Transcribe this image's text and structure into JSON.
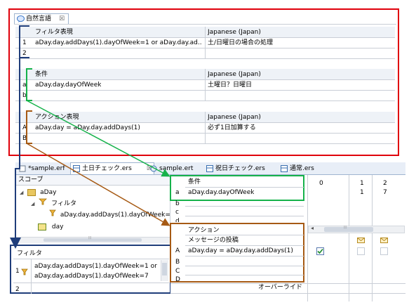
{
  "top_panel": {
    "tab_title": "自然言語",
    "tab_close": "☒",
    "filter_section": {
      "header_left": "フィルタ表現",
      "header_right": "Japanese (Japan)",
      "rows": [
        {
          "num": "1",
          "expr": "aDay.day.addDays(1).dayOfWeek=1 or aDay.day.ad...",
          "desc": "土/日曜日の場合の処理"
        },
        {
          "num": "2",
          "expr": "",
          "desc": ""
        }
      ]
    },
    "condition_section": {
      "header_left": "条件",
      "header_right": "Japanese (Japan)",
      "rows": [
        {
          "num": "a",
          "expr": "aDay.day.dayOfWeek",
          "desc": "土曜日？日曜日"
        },
        {
          "num": "b",
          "expr": "",
          "desc": ""
        }
      ]
    },
    "action_section": {
      "header_left": "アクション表現",
      "header_right": "Japanese (Japan)",
      "rows": [
        {
          "num": "A",
          "expr": "aDay.day = aDay.day.addDays(1)",
          "desc": "必ず1日加算する"
        },
        {
          "num": "B",
          "expr": "",
          "desc": ""
        }
      ]
    }
  },
  "editor_tabs": [
    {
      "label": "*sample.erf",
      "active": false
    },
    {
      "label": "土日チェック.ers",
      "active": true,
      "close": "☒"
    },
    {
      "label": "sample.ert",
      "active": false
    },
    {
      "label": "祝日チェック.ers",
      "active": false
    },
    {
      "label": "通常.ers",
      "active": false
    }
  ],
  "scope": {
    "title": "スコープ",
    "tree": [
      {
        "label": "aDay",
        "level": 0,
        "toggle": "◢"
      },
      {
        "label": "フィルタ",
        "level": 1,
        "toggle": "◢"
      },
      {
        "label": "aDay.day.addDays(1).dayOfWeek=1",
        "level": 2
      },
      {
        "label": "day",
        "level": 1
      }
    ],
    "scroll_grip": "⦙⦙⦙"
  },
  "filter_panel": {
    "title": "フィルタ",
    "rows": [
      {
        "num": "1",
        "line1": "aDay.day.addDays(1).dayOfWeek=1 or",
        "line2": "aDay.day.addDays(1).dayOfWeek=7"
      },
      {
        "num": "2",
        "line1": "",
        "line2": ""
      }
    ]
  },
  "decision_table": {
    "condition_header": "条件",
    "columns": [
      "0",
      "1",
      "2"
    ],
    "condition_rows": [
      {
        "id": "a",
        "expr": "aDay.day.dayOfWeek",
        "values": [
          "",
          "1",
          "7"
        ]
      },
      {
        "id": "b",
        "expr": "",
        "values": [
          "",
          "",
          ""
        ]
      },
      {
        "id": "c",
        "expr": "",
        "values": [
          "",
          "",
          ""
        ]
      },
      {
        "id": "d",
        "expr": "",
        "values": [
          "",
          "",
          ""
        ]
      }
    ],
    "action_header": "アクション",
    "message_row": "メッセージの投稿",
    "action_rows": [
      {
        "id": "A",
        "expr": "aDay.day = aDay.day.addDays(1)"
      },
      {
        "id": "B",
        "expr": ""
      },
      {
        "id": "C",
        "expr": ""
      },
      {
        "id": "D",
        "expr": ""
      }
    ],
    "override_label": "オーバーライド",
    "scroll_left": "◂",
    "scroll_grip": "⦙⦙⦙"
  },
  "colors": {
    "red_box": "#e0000b",
    "green_box": "#16b24b",
    "brown_box": "#a65a14",
    "navy_box": "#1f3d7a"
  }
}
